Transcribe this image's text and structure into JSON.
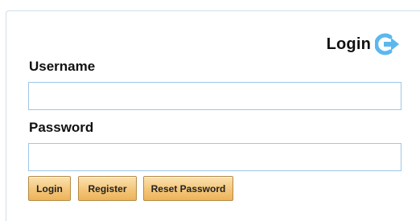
{
  "header": {
    "title": "Login",
    "icon": "login-arrow-icon",
    "icon_color": "#5bb8ee"
  },
  "form": {
    "username_label": "Username",
    "username_value": "",
    "password_label": "Password",
    "password_value": ""
  },
  "buttons": {
    "login_label": "Login",
    "register_label": "Register",
    "reset_label": "Reset Password"
  },
  "colors": {
    "input_border": "#9fc6e8",
    "button_fill": "#f4c679",
    "button_border": "#b48a45"
  }
}
